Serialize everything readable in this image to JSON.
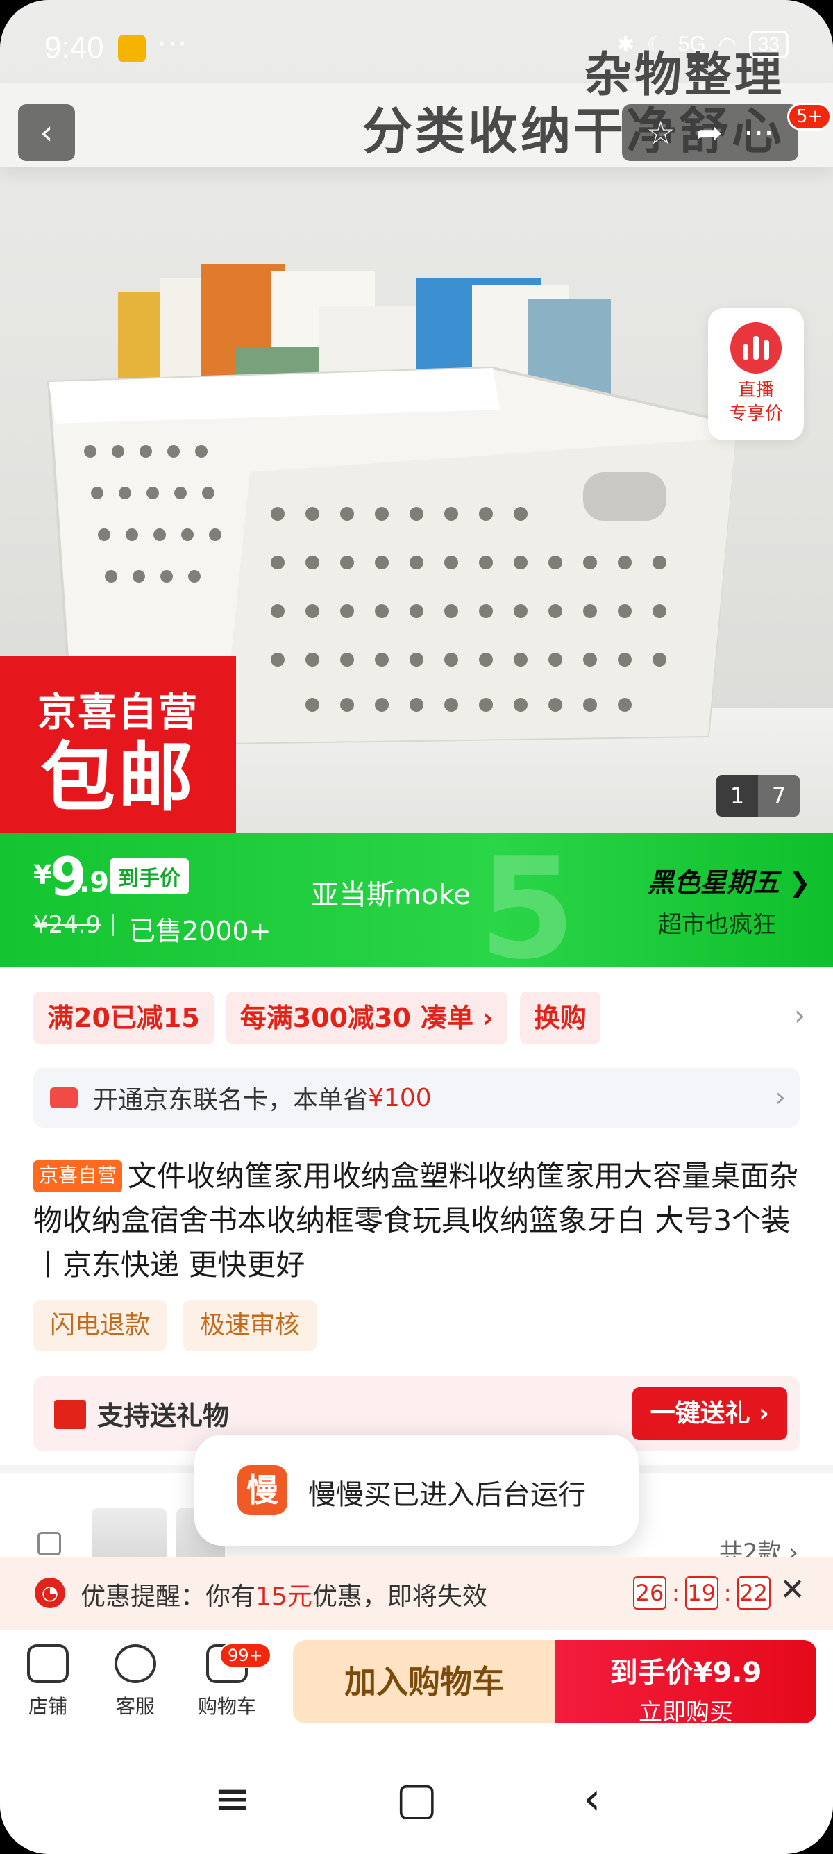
{
  "status_bar": {
    "time": "9:40",
    "dots": "···",
    "signal": "5G",
    "battery": "33"
  },
  "hero": {
    "headline_line1": "杂物整理",
    "headline_line2": "分类收纳干净舒心",
    "badge": "5+",
    "live": {
      "line1": "直播",
      "line2": "专享价"
    },
    "ad_line1": "京喜自营",
    "ad_line2": "包邮",
    "pager": {
      "current": "1",
      "total": "7"
    }
  },
  "price": {
    "currency": "¥",
    "integer": "9",
    "decimal": ".9",
    "tag": "到手价",
    "original": "¥24.9",
    "sold": "已售2000+",
    "store": "亚当斯moke",
    "promo_title": "黑色星期五",
    "promo_sub": "超市也疯狂"
  },
  "coupons": [
    {
      "label": "满20已减15"
    },
    {
      "label": "每满300减30",
      "sub": "凑单 ›"
    },
    {
      "label": "换购"
    }
  ],
  "card_offer": {
    "text": "开通京东联名卡，本单省",
    "amount": "¥100"
  },
  "product": {
    "tag": "京喜自营",
    "title": "文件收纳筐家用收纳盒塑料收纳筐家用大容量桌面杂物收纳盒宿舍书本收纳框零食玩具收纳篮象牙白 大号3个装丨京东快递 更快更好"
  },
  "services": [
    "闪电退款",
    "极速审核"
  ],
  "gift": {
    "label": "支持送礼物",
    "button": "一键送礼 ›"
  },
  "variants": {
    "count": "共2款 ›"
  },
  "toast": {
    "icon": "慢",
    "text": "慢慢买已进入后台运行"
  },
  "reminder": {
    "prefix": "优惠提醒：你有",
    "amount": "15元",
    "suffix": "优惠，即将失效",
    "hh": "26",
    "mm": "19",
    "ss": "22"
  },
  "bottom_bar": {
    "shop": "店铺",
    "service": "客服",
    "cart": "购物车",
    "cart_badge": "99+",
    "add_to_cart": "加入购物车",
    "buy_line1": "到手价¥9.9",
    "buy_line2": "立即购买"
  },
  "colors": {
    "brand_red": "#e2231a",
    "promo_green": "#1ccb38",
    "cart_bg": "#ffe3c2"
  }
}
